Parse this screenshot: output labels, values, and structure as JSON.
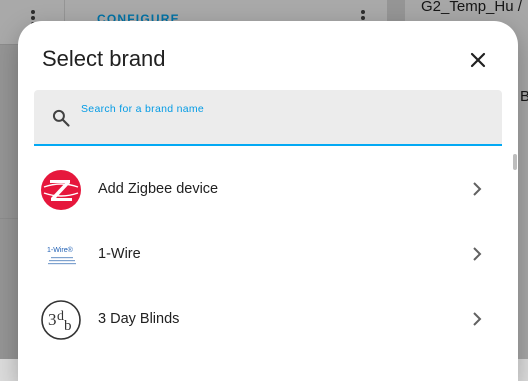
{
  "background": {
    "configure_label": "CONFIGURE",
    "device_title": "G2_Temp_Hu /",
    "side_letter": "B"
  },
  "dialog": {
    "title": "Select brand",
    "search": {
      "label": "Search for a brand name",
      "value": ""
    },
    "items": [
      {
        "label": "Add Zigbee device",
        "icon": "zigbee-logo"
      },
      {
        "label": "1-Wire",
        "icon": "1-wire-logo"
      },
      {
        "label": "3 Day Blinds",
        "icon": "3-day-blinds-logo"
      }
    ]
  },
  "colors": {
    "accent": "#03a9f4",
    "zigbee": "#e6173c"
  }
}
